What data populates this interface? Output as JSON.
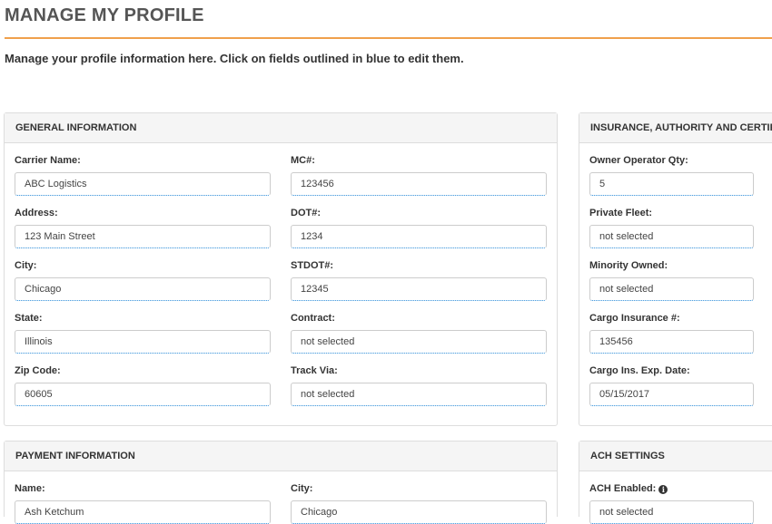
{
  "page": {
    "title": "MANAGE MY PROFILE",
    "intro": "Manage your profile information here. Click on fields outlined in blue to edit them."
  },
  "general": {
    "heading": "GENERAL INFORMATION",
    "fields": [
      {
        "label": "Carrier Name:",
        "value": "ABC Logistics"
      },
      {
        "label": "MC#:",
        "value": "123456"
      },
      {
        "label": "Address:",
        "value": "123 Main Street"
      },
      {
        "label": "DOT#:",
        "value": "1234"
      },
      {
        "label": "City:",
        "value": "Chicago"
      },
      {
        "label": "STDOT#:",
        "value": "12345"
      },
      {
        "label": "State:",
        "value": "Illinois"
      },
      {
        "label": "Contract:",
        "value": "not selected"
      },
      {
        "label": "Zip Code:",
        "value": "60605"
      },
      {
        "label": "Track Via:",
        "value": "not selected"
      }
    ]
  },
  "insurance": {
    "heading": "INSURANCE, AUTHORITY AND CERTIF",
    "fields": [
      {
        "label": "Owner Operator Qty:",
        "value": "5"
      },
      {
        "label": "Private Fleet:",
        "value": "not selected"
      },
      {
        "label": "Minority Owned:",
        "value": "not selected"
      },
      {
        "label": "Cargo Insurance #:",
        "value": "135456"
      },
      {
        "label": "Cargo Ins. Exp. Date:",
        "value": "05/15/2017"
      }
    ]
  },
  "payment": {
    "heading": "PAYMENT INFORMATION",
    "fields": [
      {
        "label": "Name:",
        "value": "Ash Ketchum"
      },
      {
        "label": "City:",
        "value": "Chicago"
      }
    ]
  },
  "ach": {
    "heading": "ACH SETTINGS",
    "fields": [
      {
        "label": "ACH Enabled:",
        "value": "not selected",
        "icon": "info-icon"
      }
    ]
  }
}
